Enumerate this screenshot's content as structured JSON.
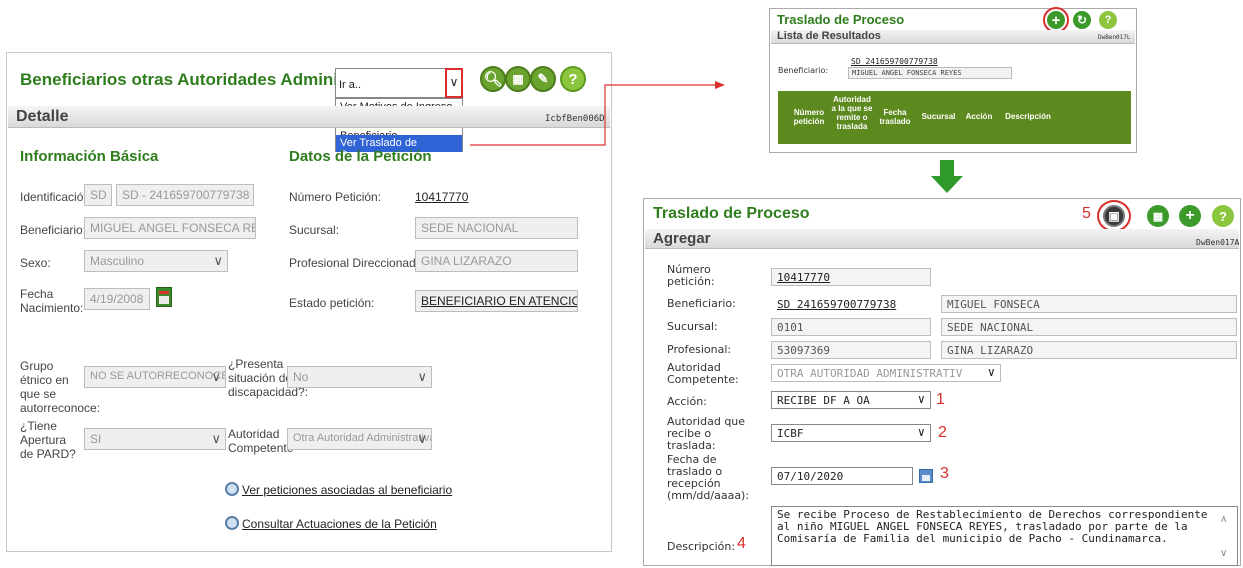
{
  "left": {
    "title": "Beneficiarios otras Autoridades Administrativas",
    "goto_value": "Ir a..",
    "goto_options": [
      "Ver Motivos de Ingreso",
      "Ver Ubicación Beneficiario",
      "Ver Traslado de Procesos"
    ],
    "section": "Detalle",
    "code": "IcbfBen006D",
    "info_basica": "Información Básica",
    "datos_peticion": "Datos de la Petición",
    "identificacion_label": "Identificación:",
    "identificacion_tipo": "SD",
    "identificacion_valor": "SD - 241659700779738",
    "beneficiario_label": "Beneficiario:",
    "beneficiario_valor": "MIGUEL ANGEL FONSECA REY",
    "sexo_label": "Sexo:",
    "sexo_valor": "Masculino",
    "fecha_label": "Fecha Nacimiento:",
    "fecha_valor": "4/19/2008",
    "numero_label": "Número Petición:",
    "numero_valor": "10417770",
    "sucursal_label": "Sucursal:",
    "sucursal_valor": "SEDE NACIONAL",
    "profesional_label": "Profesional Direccionado:",
    "profesional_valor": "GINA LIZARAZO",
    "estado_label": "Estado petición:",
    "estado_valor": "BENEFICIARIO EN ATENCION",
    "grupo_label": "Grupo étnico en que se autorreconoce:",
    "grupo_valor": "NO SE AUTORRECONOCE EN",
    "discapacidad_label": "¿Presenta situación de discapacidad?:",
    "discapacidad_valor": "No",
    "pard_label": "¿Tiene Apertura de PARD?",
    "pard_valor": "SI",
    "autoridad_label": "Autoridad Competente",
    "autoridad_valor": "Otra Autoridad Administrativa",
    "link1": "Ver peticiones asociadas al beneficiario",
    "link2": "Consultar Actuaciones de la Petición"
  },
  "top_right": {
    "title": "Traslado de Proceso",
    "subtitle": "Lista de Resultados",
    "code": "DwBen017L",
    "beneficiario_label": "Beneficiario:",
    "beneficiario_id": "SD 241659700779738",
    "beneficiario_nombre": "MIGUEL ANGEL FONSECA REYES",
    "columns": [
      "Número petición",
      "Autoridad a la que se remite o traslada",
      "Fecha traslado",
      "Sucursal",
      "Acción",
      "Descripción"
    ]
  },
  "bottom_right": {
    "title": "Traslado de Proceso",
    "section": "Agregar",
    "code": "DwBen017A",
    "numero_label": "Número petición:",
    "numero_valor": "10417770",
    "beneficiario_label": "Beneficiario:",
    "beneficiario_id": "SD 241659700779738",
    "beneficiario_nombre": "MIGUEL FONSECA",
    "sucursal_label": "Sucursal:",
    "sucursal_codigo": "0101",
    "sucursal_nombre": "SEDE NACIONAL",
    "profesional_label": "Profesional:",
    "profesional_codigo": "53097369",
    "profesional_nombre": "GINA LIZARAZO",
    "autoridad_label": "Autoridad Competente:",
    "autoridad_valor": "OTRA AUTORIDAD ADMINISTRATIV",
    "accion_label": "Acción:",
    "accion_valor": "RECIBE DF A OA",
    "autoridad_recibe_label": "Autoridad que recibe o traslada:",
    "autoridad_recibe_valor": "ICBF",
    "fecha_label": "Fecha de traslado o recepción (mm/dd/aaaa):",
    "fecha_valor": "07/10/2020",
    "descripcion_label": "Descripción:",
    "descripcion_valor": "Se recibe Proceso de Restablecimiento de Derechos correspondiente al niño MIGUEL ANGEL FONSECA REYES, trasladado por parte de la Comisaría de Familia del municipio de Pacho - Cundinamarca.",
    "step1": "1",
    "step2": "2",
    "step3": "3",
    "step4": "4",
    "step5": "5"
  },
  "colors": {
    "green": "#2f7d1d",
    "red": "#d9302c",
    "table_header": "#5c8a1e",
    "highlight": "#2f63d6"
  }
}
